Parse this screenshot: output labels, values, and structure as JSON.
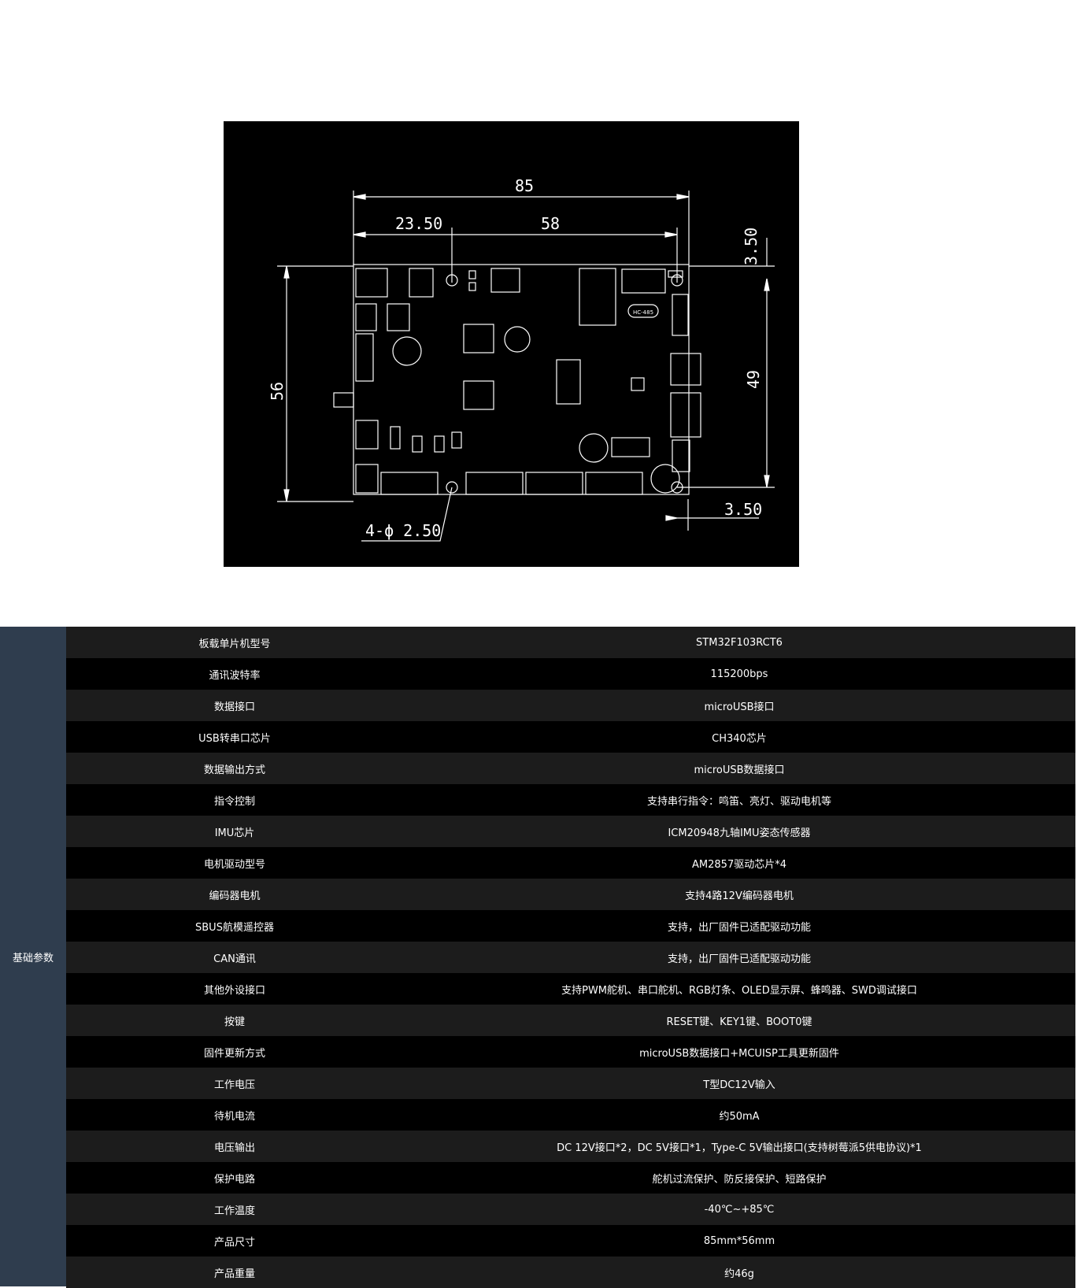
{
  "drawing": {
    "dim_width_total": "85",
    "dim_offset_left": "23.50",
    "dim_hole_spacing_x": "58",
    "dim_top_margin": "3.50",
    "dim_height_total": "56",
    "dim_hole_spacing_y": "49",
    "dim_bottom_margin": "3.50",
    "hole_callout": "4-ϕ 2.50",
    "chip_label": "HC-485"
  },
  "specs": {
    "group_label": "基础参数",
    "rows": [
      {
        "key": "板载单片机型号",
        "value": "STM32F103RCT6"
      },
      {
        "key": "通讯波特率",
        "value": "115200bps"
      },
      {
        "key": "数据接口",
        "value": "microUSB接口"
      },
      {
        "key": "USB转串口芯片",
        "value": "CH340芯片"
      },
      {
        "key": "数据输出方式",
        "value": "microUSB数据接口"
      },
      {
        "key": "指令控制",
        "value": "支持串行指令：鸣笛、亮灯、驱动电机等"
      },
      {
        "key": "IMU芯片",
        "value": "ICM20948九轴IMU姿态传感器"
      },
      {
        "key": "电机驱动型号",
        "value": "AM2857驱动芯片*4"
      },
      {
        "key": "编码器电机",
        "value": "支持4路12V编码器电机"
      },
      {
        "key": "SBUS航模遥控器",
        "value": "支持，出厂固件已适配驱动功能"
      },
      {
        "key": "CAN通讯",
        "value": "支持，出厂固件已适配驱动功能"
      },
      {
        "key": "其他外设接口",
        "value": "支持PWM舵机、串口舵机、RGB灯条、OLED显示屏、蜂鸣器、SWD调试接口"
      },
      {
        "key": "按键",
        "value": "RESET键、KEY1键、BOOT0键"
      },
      {
        "key": "固件更新方式",
        "value": "microUSB数据接口+MCUISP工具更新固件"
      },
      {
        "key": "工作电压",
        "value": "T型DC12V输入"
      },
      {
        "key": "待机电流",
        "value": "约50mA"
      },
      {
        "key": "电压输出",
        "value": "DC 12V接口*2，DC 5V接口*1，Type-C 5V输出接口(支持树莓派5供电协议)*1"
      },
      {
        "key": "保护电路",
        "value": "舵机过流保护、防反接保护、短路保护"
      },
      {
        "key": "工作温度",
        "value": "-40℃~+85℃"
      },
      {
        "key": "产品尺寸",
        "value": "85mm*56mm"
      },
      {
        "key": "产品重量",
        "value": "约46g"
      }
    ]
  }
}
